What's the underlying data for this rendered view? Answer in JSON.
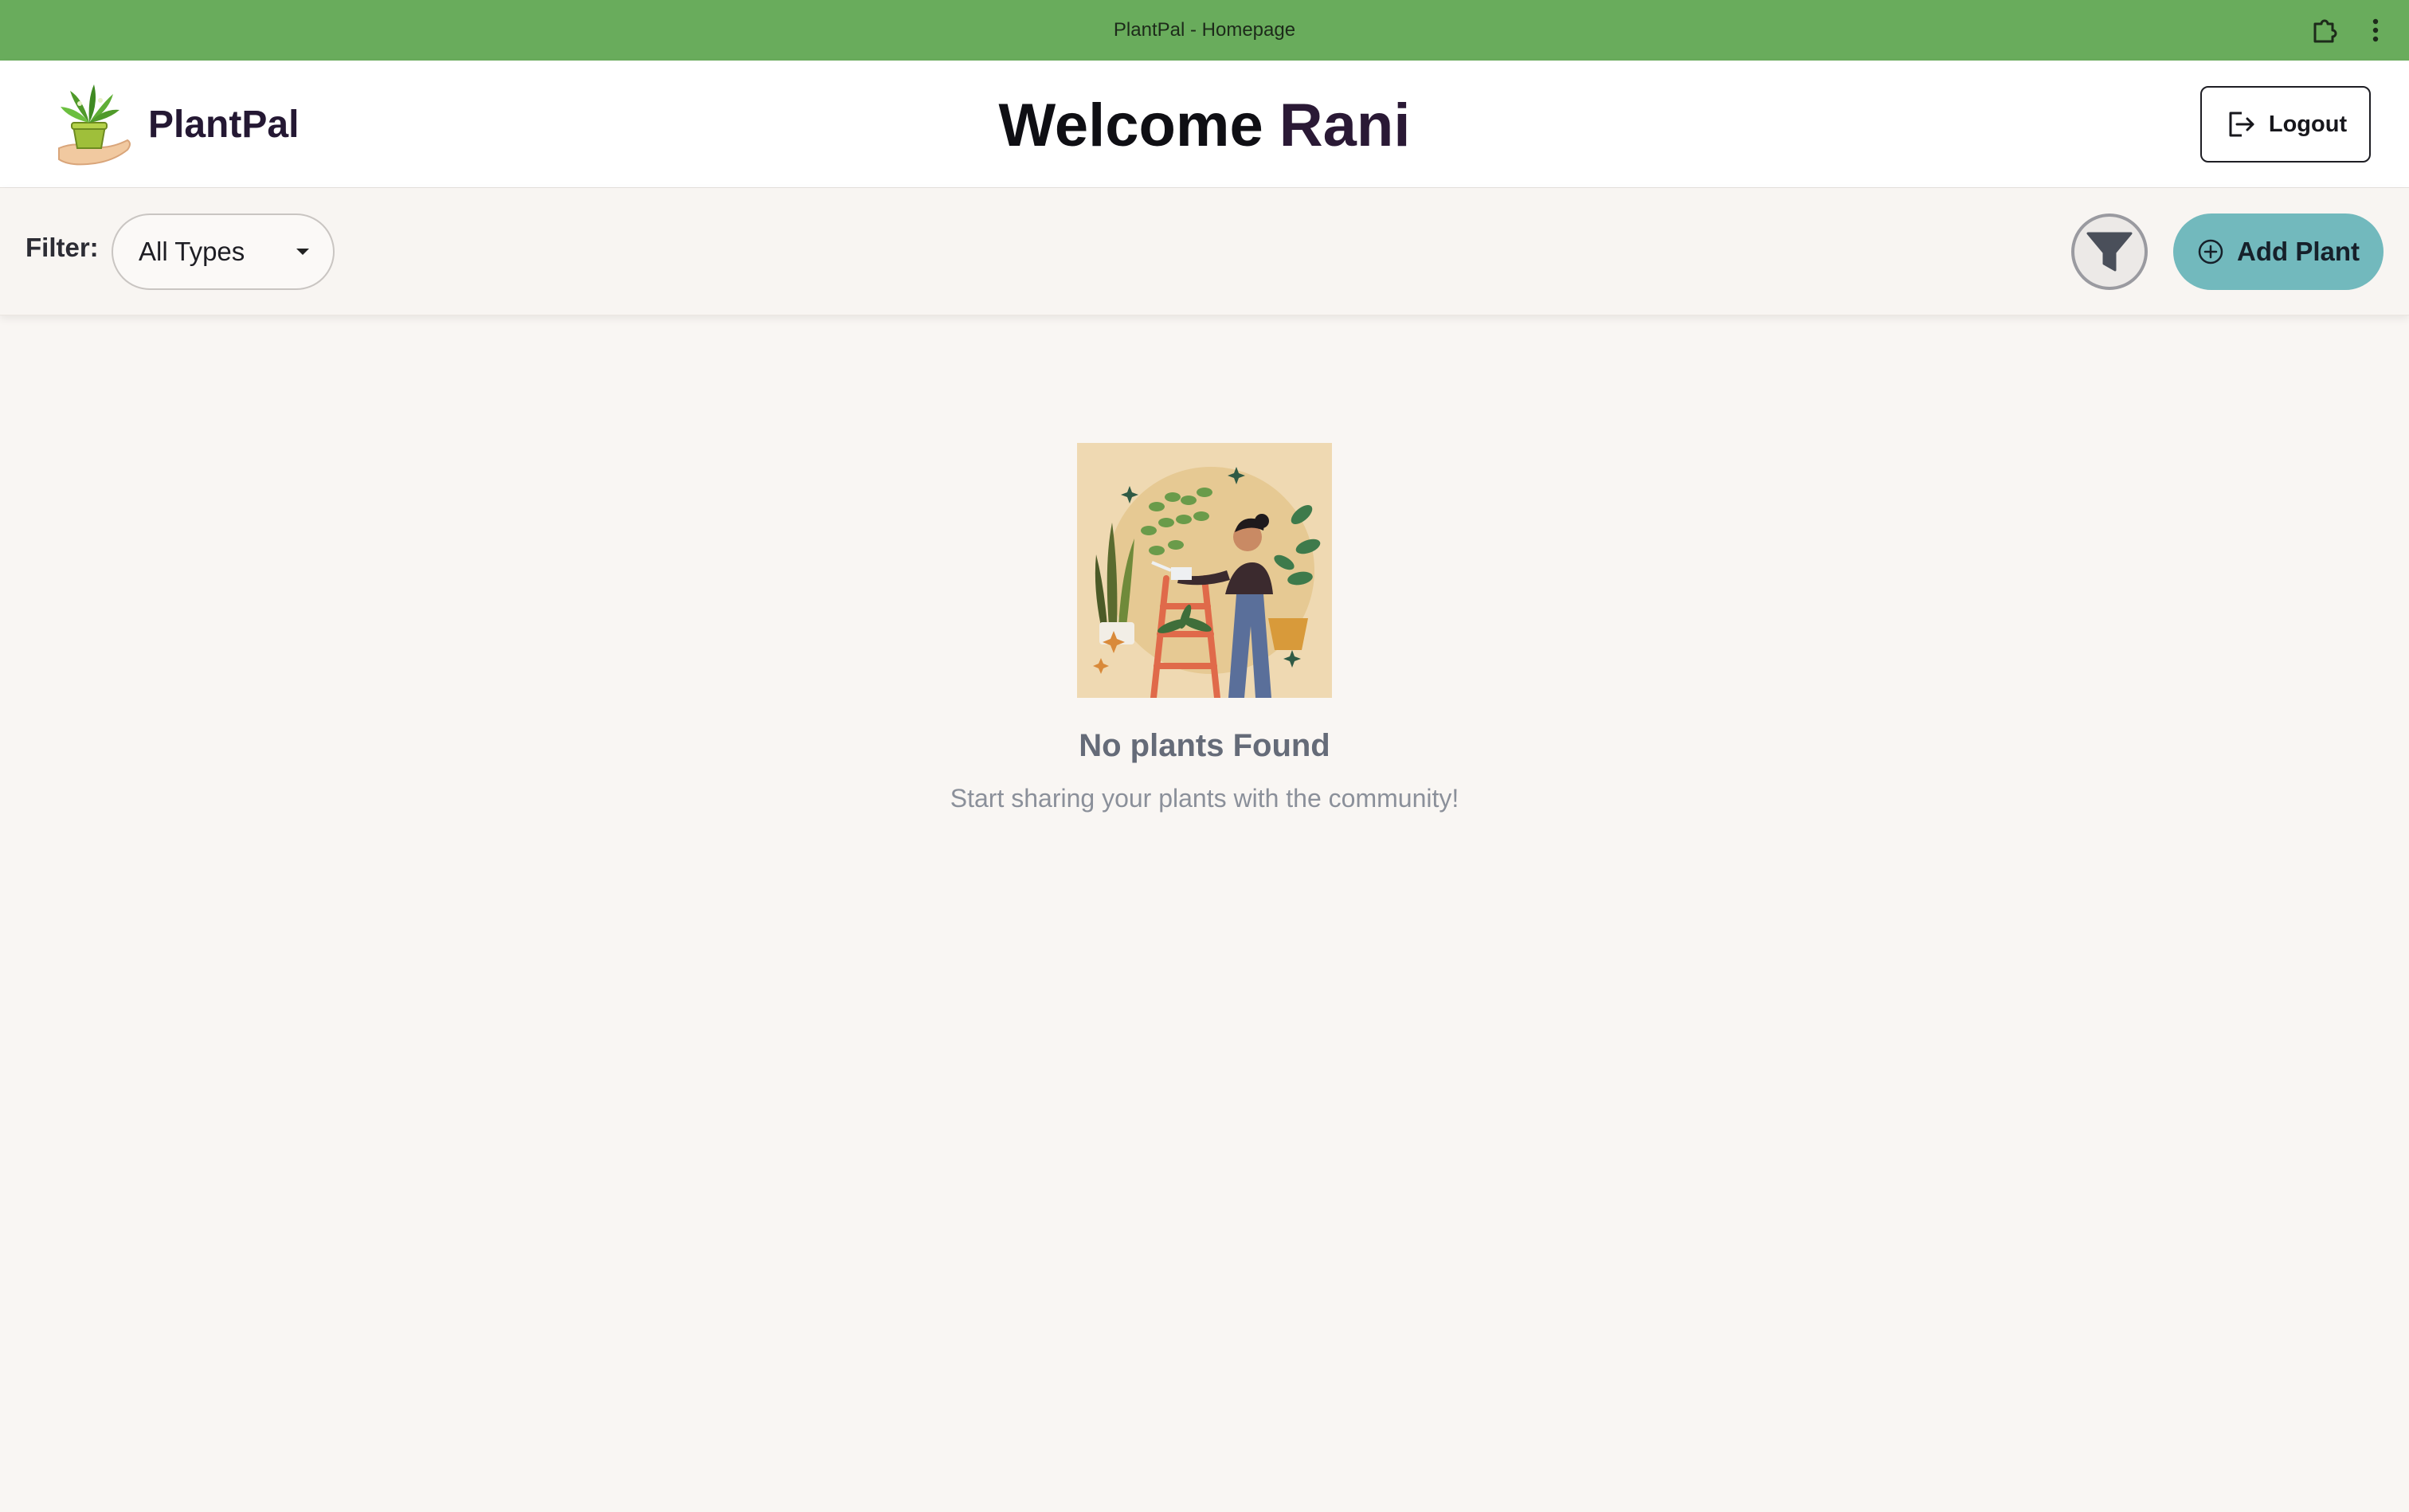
{
  "browser": {
    "title": "PlantPal - Homepage",
    "extension_icon": "puzzle-icon",
    "menu_icon": "kebab-menu-icon"
  },
  "header": {
    "brand_name": "PlantPal",
    "logo_icon": "potted-plant-in-hand-icon",
    "welcome_prefix": "Welcome",
    "username": "Rani",
    "logout_label": "Logout",
    "logout_icon": "logout-icon"
  },
  "filterbar": {
    "label": "Filter:",
    "selected_type": "All Types",
    "filter_button_icon": "funnel-icon",
    "add_label": "Add Plant",
    "add_icon": "plus-circle-icon"
  },
  "empty_state": {
    "illustration": "person-watering-plants-illustration",
    "title": "No plants Found",
    "subtitle": "Start sharing your plants with the community!"
  },
  "colors": {
    "titlebar": "#69ac5c",
    "background": "#f9f6f3",
    "accent_button": "#72b9bd",
    "brand_text": "#241833"
  }
}
